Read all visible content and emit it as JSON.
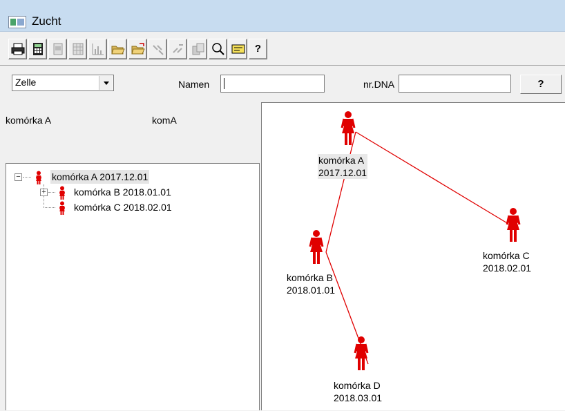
{
  "window": {
    "title": "Zucht"
  },
  "toolbar": {
    "help_label": "?",
    "buttons": [
      {
        "icon": "printer-icon"
      },
      {
        "icon": "calculator-icon"
      },
      {
        "icon": "page-icon",
        "disabled": true
      },
      {
        "icon": "page-grid-icon",
        "disabled": true
      },
      {
        "icon": "bar-chart-icon",
        "disabled": true
      },
      {
        "icon": "open-folder-icon"
      },
      {
        "icon": "open-folder-arrow-icon"
      },
      {
        "icon": "link-tool-icon",
        "disabled": true
      },
      {
        "icon": "pair-tool-icon",
        "disabled": true
      },
      {
        "icon": "copy-page-icon",
        "disabled": true
      },
      {
        "icon": "magnifier-icon"
      },
      {
        "icon": "card-icon"
      },
      {
        "icon": "help-icon"
      }
    ]
  },
  "filter": {
    "type_selected": "Zelle",
    "name_label": "Namen",
    "name_value": "",
    "dna_label": "nr.DNA",
    "dna_value": "",
    "help_button": "?"
  },
  "info": {
    "name": "komórka A",
    "short": "komA"
  },
  "tree": {
    "root": {
      "label": "komórka A 2017.12.01",
      "expander": "−"
    },
    "children": [
      {
        "label": "komórka B 2018.01.01",
        "expander": "+"
      },
      {
        "label": "komórka C 2018.02.01"
      }
    ]
  },
  "diagram": {
    "nodes": [
      {
        "id": "A",
        "name": "komórka A",
        "date": "2017.12.01",
        "selected": true
      },
      {
        "id": "B",
        "name": "komórka B",
        "date": "2018.01.01"
      },
      {
        "id": "C",
        "name": "komórka C",
        "date": "2018.02.01"
      },
      {
        "id": "D",
        "name": "komórka D",
        "date": "2018.03.01"
      }
    ],
    "edges": [
      [
        "A",
        "B"
      ],
      [
        "A",
        "C"
      ],
      [
        "B",
        "D"
      ]
    ],
    "colors": {
      "figure": "#e00000",
      "edge": "#e00000"
    }
  }
}
